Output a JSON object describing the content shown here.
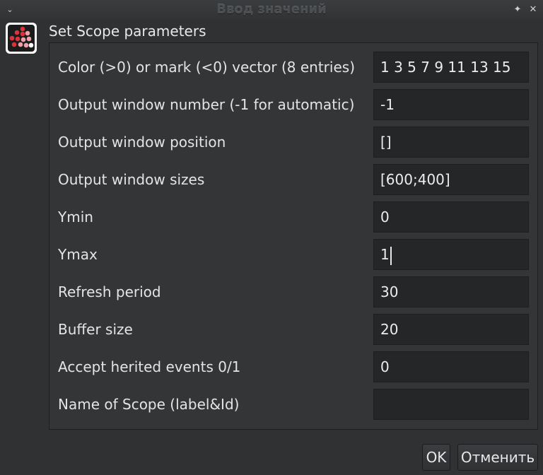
{
  "window": {
    "title": "Ввод значений",
    "menu_icon": "chevron-down-icon",
    "pin_icon": "pin-icon",
    "close_icon": "close-icon"
  },
  "dialog": {
    "header": "Set Scope parameters",
    "icon": "scilab-dots-icon",
    "fields": [
      {
        "label": "Color (>0) or mark (<0) vector (8 entries)",
        "value": "1 3 5 7 9 11 13 15"
      },
      {
        "label": "Output window number (-1 for automatic)",
        "value": "-1"
      },
      {
        "label": "Output window position",
        "value": "[]"
      },
      {
        "label": "Output window sizes",
        "value": "[600;400]"
      },
      {
        "label": "Ymin",
        "value": "0"
      },
      {
        "label": "Ymax",
        "value": "1"
      },
      {
        "label": "Refresh period",
        "value": "30"
      },
      {
        "label": "Buffer size",
        "value": "20"
      },
      {
        "label": "Accept herited events 0/1",
        "value": "0"
      },
      {
        "label": "Name of Scope (label&Id)",
        "value": ""
      }
    ]
  },
  "buttons": {
    "ok": "OK",
    "cancel": "Отменить"
  },
  "colors": {
    "background": "#2f3133",
    "field_background": "#252628",
    "icon_red": "#d8343c",
    "icon_pink": "#f0a0a8"
  }
}
